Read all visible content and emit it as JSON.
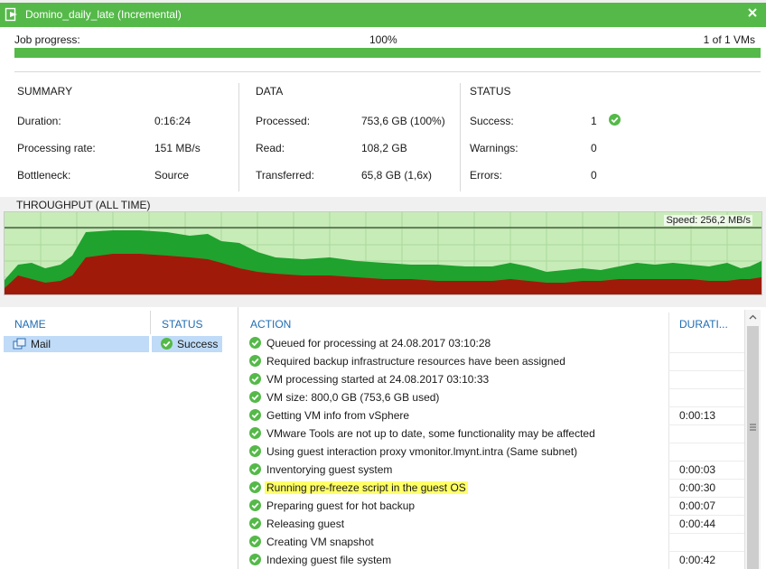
{
  "window": {
    "title": "Domino_daily_late (Incremental)"
  },
  "job": {
    "label": "Job progress:",
    "percent_text": "100%",
    "vms_text": "1 of 1 VMs",
    "progress": 1.0
  },
  "summary": {
    "heading": "SUMMARY",
    "rows": [
      {
        "label": "Duration:",
        "value": "0:16:24"
      },
      {
        "label": "Processing rate:",
        "value": "151 MB/s"
      },
      {
        "label": "Bottleneck:",
        "value": "Source"
      }
    ]
  },
  "data": {
    "heading": "DATA",
    "rows": [
      {
        "label": "Processed:",
        "value": "753,6 GB (100%)"
      },
      {
        "label": "Read:",
        "value": "108,2 GB"
      },
      {
        "label": "Transferred:",
        "value": "65,8 GB (1,6x)"
      }
    ]
  },
  "status": {
    "heading": "STATUS",
    "rows": [
      {
        "label": "Success:",
        "value": "1"
      },
      {
        "label": "Warnings:",
        "value": "0"
      },
      {
        "label": "Errors:",
        "value": "0"
      }
    ]
  },
  "throughput": {
    "title": "THROUGHPUT (ALL TIME)",
    "speed_text": "Speed: 256,2 MB/s"
  },
  "vm_table": {
    "name_header": "NAME",
    "status_header": "STATUS",
    "vm": {
      "name": "Mail",
      "status": "Success"
    }
  },
  "log": {
    "action_header": "ACTION",
    "duration_header": "DURATI...",
    "rows": [
      {
        "action": "Queued for processing at 24.08.2017 03:10:28",
        "duration": ""
      },
      {
        "action": "Required backup infrastructure resources have been assigned",
        "duration": ""
      },
      {
        "action": "VM processing started at 24.08.2017 03:10:33",
        "duration": ""
      },
      {
        "action": "VM size: 800,0 GB (753,6 GB used)",
        "duration": ""
      },
      {
        "action": "Getting VM info from vSphere",
        "duration": "0:00:13"
      },
      {
        "action": "VMware Tools are not up to date, some functionality may be affected",
        "duration": ""
      },
      {
        "action": "Using guest interaction proxy vmonitor.lmynt.intra (Same subnet)",
        "duration": ""
      },
      {
        "action": "Inventorying guest system",
        "duration": "0:00:03"
      },
      {
        "action": "Running pre-freeze script in the guest OS",
        "duration": "0:00:30",
        "highlight": true
      },
      {
        "action": "Preparing guest for hot backup",
        "duration": "0:00:07"
      },
      {
        "action": "Releasing guest",
        "duration": "0:00:44"
      },
      {
        "action": "Creating VM snapshot",
        "duration": ""
      },
      {
        "action": "Indexing guest file system",
        "duration": "0:00:42"
      }
    ]
  },
  "colors": {
    "accent": "#54b948",
    "header_blue": "#1f6db3",
    "selection": "#bfdbf7",
    "highlight": "#ffff66",
    "read_fill": "#1fa22e",
    "transfer_fill": "#a01a0a",
    "chart_bg": "#c8ecb8"
  }
}
